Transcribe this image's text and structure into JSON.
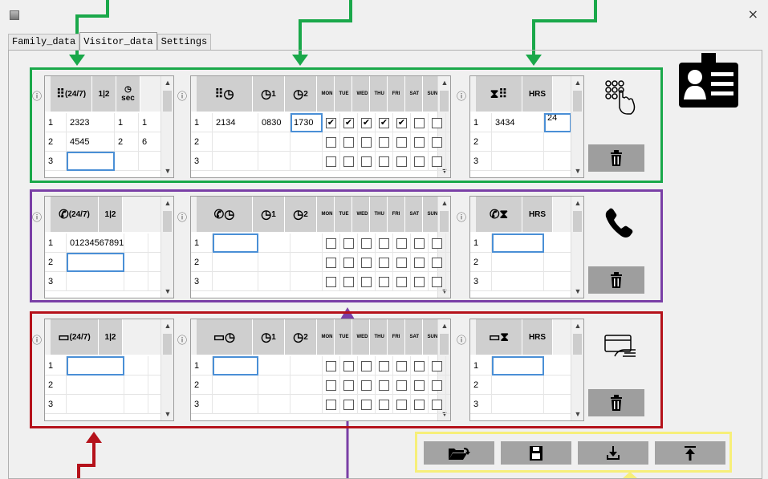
{
  "window": {
    "close_glyph": "×"
  },
  "tabs": [
    "Family_data",
    "Visitor_data",
    "Settings"
  ],
  "active_tab": "Visitor_data",
  "headers": {
    "code247": "(24/7)",
    "seq": "1|2",
    "sec": "sec",
    "clock1": "1",
    "clock2": "2",
    "hrs": "HRS",
    "days": [
      "MON",
      "TUE",
      "WED",
      "THU",
      "FRI",
      "SAT",
      "SUN"
    ]
  },
  "keypad_section": {
    "table1": {
      "rows": [
        [
          "1",
          "2323",
          "1",
          "1"
        ],
        [
          "2",
          "4545",
          "2",
          "6"
        ],
        [
          "3",
          "",
          "",
          ""
        ]
      ]
    },
    "table2": {
      "rows": [
        {
          "n": "1",
          "code": "2134",
          "t1": "0830",
          "t2": "1730",
          "days": [
            true,
            true,
            true,
            true,
            true,
            false,
            false
          ]
        },
        {
          "n": "2",
          "code": "",
          "t1": "",
          "t2": "",
          "days": [
            false,
            false,
            false,
            false,
            false,
            false,
            false
          ]
        },
        {
          "n": "3",
          "code": "",
          "t1": "",
          "t2": "",
          "days": [
            false,
            false,
            false,
            false,
            false,
            false,
            false
          ]
        }
      ]
    },
    "table3": {
      "rows": [
        [
          "1",
          "3434",
          "24"
        ],
        [
          "2",
          "",
          ""
        ],
        [
          "3",
          "",
          ""
        ]
      ]
    }
  },
  "phone_section": {
    "table1": {
      "rows": [
        [
          "1",
          "01234567891",
          ""
        ],
        [
          "2",
          "",
          ""
        ],
        [
          "3",
          "",
          ""
        ]
      ]
    },
    "table2": {
      "rows": [
        {
          "n": "1",
          "code": "",
          "t1": "",
          "t2": "",
          "days": [
            false,
            false,
            false,
            false,
            false,
            false,
            false
          ]
        },
        {
          "n": "2",
          "code": "",
          "t1": "",
          "t2": "",
          "days": [
            false,
            false,
            false,
            false,
            false,
            false,
            false
          ]
        },
        {
          "n": "3",
          "code": "",
          "t1": "",
          "t2": "",
          "days": [
            false,
            false,
            false,
            false,
            false,
            false,
            false
          ]
        }
      ]
    },
    "table3": {
      "rows": [
        [
          "1",
          "",
          ""
        ],
        [
          "2",
          "",
          ""
        ],
        [
          "3",
          "",
          ""
        ]
      ]
    }
  },
  "card_section": {
    "table1": {
      "rows": [
        [
          "1",
          "",
          ""
        ],
        [
          "2",
          "",
          ""
        ],
        [
          "3",
          "",
          ""
        ]
      ]
    },
    "table2": {
      "rows": [
        {
          "n": "1",
          "code": "",
          "t1": "",
          "t2": "",
          "days": [
            false,
            false,
            false,
            false,
            false,
            false,
            false
          ]
        },
        {
          "n": "2",
          "code": "",
          "t1": "",
          "t2": "",
          "days": [
            false,
            false,
            false,
            false,
            false,
            false,
            false
          ]
        },
        {
          "n": "3",
          "code": "",
          "t1": "",
          "t2": "",
          "days": [
            false,
            false,
            false,
            false,
            false,
            false,
            false
          ]
        }
      ]
    },
    "table3": {
      "rows": [
        [
          "1",
          "",
          ""
        ],
        [
          "2",
          "",
          ""
        ],
        [
          "3",
          "",
          ""
        ]
      ]
    }
  },
  "toolbar": {
    "buttons": [
      "open-folder",
      "save",
      "download",
      "upload"
    ]
  },
  "colors": {
    "green": "#1aa84a",
    "purple": "#7a3fa6",
    "red": "#b5121b",
    "yellow": "#f7ef79"
  }
}
